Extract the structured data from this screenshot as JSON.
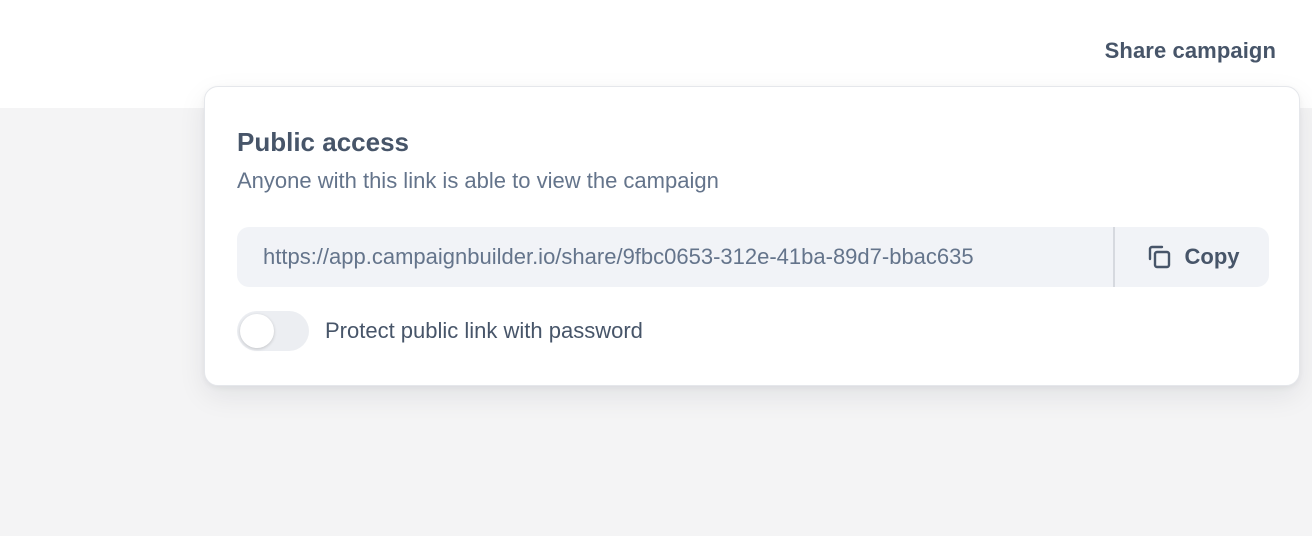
{
  "header": {
    "share_label": "Share campaign"
  },
  "popover": {
    "title": "Public access",
    "subtitle": "Anyone with this link is able to view the campaign",
    "link": {
      "url": "https://app.campaignbuilder.io/share/9fbc0653-312e-41ba-89d7-bbac635",
      "copy_label": "Copy"
    },
    "password_toggle": {
      "label": "Protect public link with password",
      "enabled": false
    }
  },
  "colors": {
    "text_primary": "#475569",
    "text_muted": "#64748b",
    "background": "#f4f4f5",
    "field_background": "#f1f3f7"
  },
  "icons": {
    "copy": "copy-icon"
  }
}
